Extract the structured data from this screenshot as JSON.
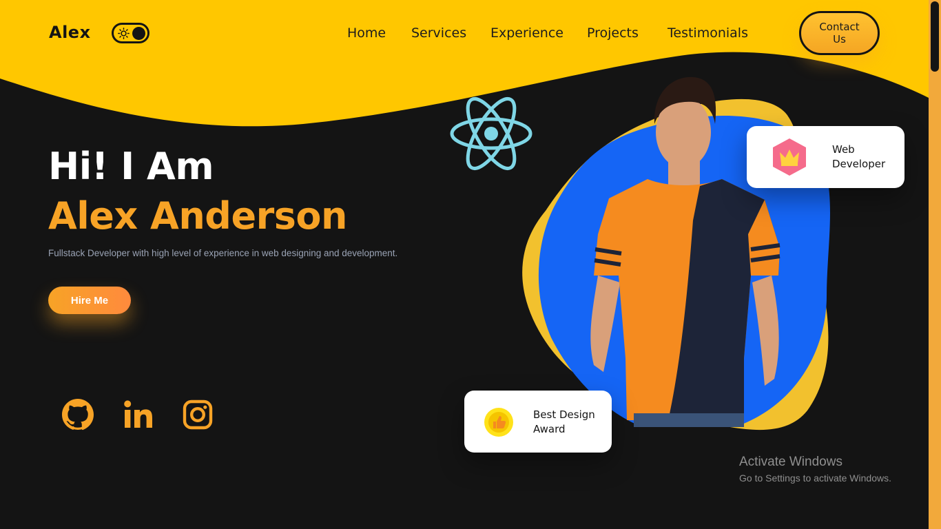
{
  "header": {
    "logo": "Alex",
    "theme_toggle": {
      "state": "dark",
      "icons": [
        "sun-icon"
      ]
    },
    "nav": [
      {
        "label": "Home"
      },
      {
        "label": "Services"
      },
      {
        "label": "Experience"
      },
      {
        "label": "Projects"
      },
      {
        "label": "Testimonials"
      }
    ],
    "contact_button": "Contact Us"
  },
  "hero": {
    "greeting": "Hi! I Am",
    "name": "Alex Anderson",
    "tagline": "Fullstack Developer with high level of experience in web designing and development.",
    "hire_button": "Hire Me",
    "socials": [
      {
        "icon": "github-icon"
      },
      {
        "icon": "linkedin-icon"
      },
      {
        "icon": "instagram-icon"
      }
    ]
  },
  "cards": {
    "web_dev": {
      "line1": "Web",
      "line2": "Developer",
      "icon": "crown-icon"
    },
    "award": {
      "line1": "Best Design",
      "line2": "Award",
      "icon": "thumbs-up-icon"
    }
  },
  "decor": {
    "icon": "react-icon"
  },
  "watermark": {
    "title": "Activate Windows",
    "subtitle": "Go to Settings to activate Windows."
  },
  "colors": {
    "accent_yellow": "#FFC700",
    "accent_orange": "#F7A326",
    "background": "#141414",
    "blob_blue": "#1565F5",
    "react_cyan": "#7FD6E6"
  }
}
